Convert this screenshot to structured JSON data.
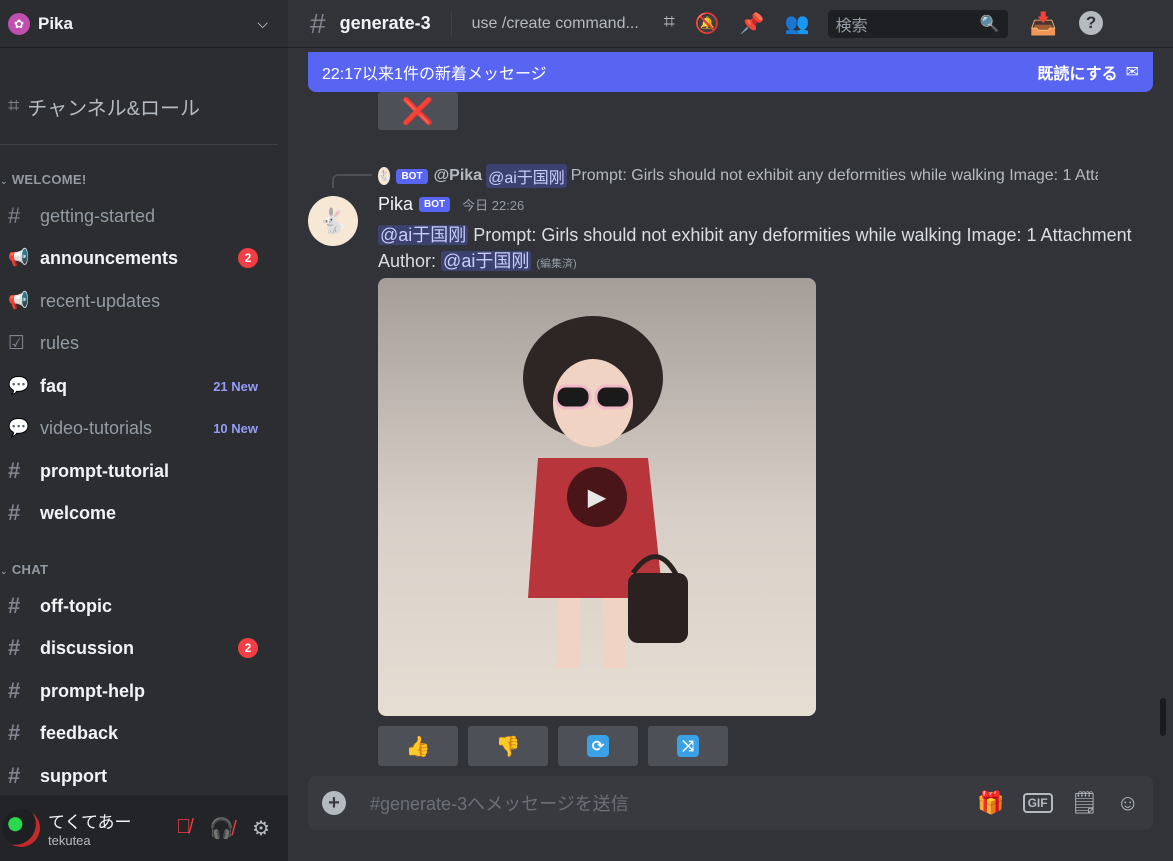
{
  "server": {
    "name": "Pika",
    "logo_icon": "pika-logo-icon",
    "chevron": "⌄"
  },
  "browse": {
    "label": "チャンネル&ロール"
  },
  "categories": [
    {
      "name": "WELCOME!"
    },
    {
      "name": "CHAT"
    }
  ],
  "channels": [
    {
      "name": "getting-started",
      "icon": "#",
      "unread": false
    },
    {
      "name": "announcements",
      "icon": "📢",
      "unread": true,
      "badge": "2"
    },
    {
      "name": "recent-updates",
      "icon": "📢",
      "unread": false
    },
    {
      "name": "rules",
      "icon": "☑",
      "unread": false
    },
    {
      "name": "faq",
      "icon": "💬",
      "unread": true,
      "new": "21 New"
    },
    {
      "name": "video-tutorials",
      "icon": "💬",
      "unread": false,
      "new": "10 New"
    },
    {
      "name": "prompt-tutorial",
      "icon": "#",
      "unread": true
    },
    {
      "name": "welcome",
      "icon": "#",
      "unread": true
    },
    {
      "name": "off-topic",
      "icon": "#",
      "unread": true
    },
    {
      "name": "discussion",
      "icon": "#",
      "unread": true,
      "badge": "2"
    },
    {
      "name": "prompt-help",
      "icon": "#",
      "unread": true
    },
    {
      "name": "feedback",
      "icon": "#",
      "unread": true
    },
    {
      "name": "support",
      "icon": "#",
      "unread": true
    }
  ],
  "user": {
    "display_name": "てくてあー",
    "username": "tekutea"
  },
  "header": {
    "channel": "generate-3",
    "topic": "use /create command...",
    "search_placeholder": "検索"
  },
  "new_messages": {
    "text": "22:17以来1件の新着メッセージ",
    "mark_read": "既読にする"
  },
  "prev_button": {
    "icon": "❌"
  },
  "reply": {
    "bot_tag": "BOT",
    "author": "@Pika",
    "mention": "@ai于国刚",
    "text": "Prompt: Girls should not exhibit any deformities while walking Image: 1 Attachment"
  },
  "message": {
    "author": "Pika",
    "bot_tag": "BOT",
    "time": "今日 22:26",
    "mention": "@ai于国刚",
    "text1": " Prompt: Girls should not exhibit any deformities while walking  Image: 1 Attachment  Author: ",
    "mention2": "@ai于国刚",
    "edited": "(編集済)"
  },
  "actions": [
    {
      "name": "thumbs-up",
      "icon": "👍"
    },
    {
      "name": "thumbs-down",
      "icon": "👎"
    },
    {
      "name": "refresh",
      "icon": "🔄"
    },
    {
      "name": "shuffle",
      "icon": "🔀"
    }
  ],
  "composer": {
    "placeholder": "#generate-3へメッセージを送信",
    "gif_label": "GIF"
  },
  "colors": {
    "accent": "#5865f2",
    "mention_bg": "#3c4270",
    "badge": "#f23f43"
  }
}
